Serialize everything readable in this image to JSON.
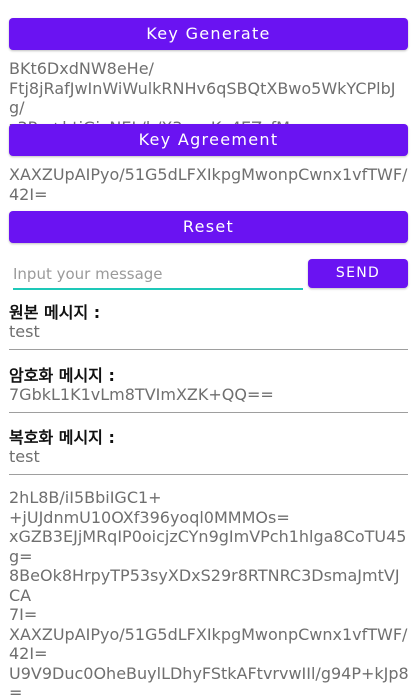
{
  "buttons": {
    "key_generate": "Key Generate",
    "key_agreement": "Key Agreement",
    "reset": "Reset",
    "send": "SEND"
  },
  "generated_key": "BKt6DxdNW8eHe/\nFtj8jRafJwInWiWulkRNHv6qSBQtXBwo5WkYCPlbJg/\nz3Rn+btjGjyNEL/h/X3azpKx4EZzfM=",
  "agreement_key": "XAXZUpAIPyo/51G5dLFXIkpgMwonpCwnx1vfTWF/\n42I=",
  "input": {
    "placeholder": "Input your message",
    "value": ""
  },
  "original": {
    "label": "원본 메시지 :",
    "value": "test"
  },
  "encrypted": {
    "label": "암호화 메시지 :",
    "value": "7GbkL1K1vLm8TVImXZK+QQ=="
  },
  "decrypted": {
    "label": "복호화 메시지 :",
    "value": "test"
  },
  "log": "2hL8B/iI5BbiIGC1+\n+jUJdnmU10OXf396yoql0MMMOs=\nxGZB3EJjMRqIP0oicjzCYn9gImVPch1hlga8CoTU45g=\n8BeOk8HrpyTP53syXDxS29r8RTNRC3DsmaJmtVJCA\n7I=\nXAXZUpAIPyo/51G5dLFXIkpgMwonpCwnx1vfTWF/\n42I=\nU9V9Duc0OheBuylLDhyFStkAFtvrvwIIl/g94P+kJp8="
}
